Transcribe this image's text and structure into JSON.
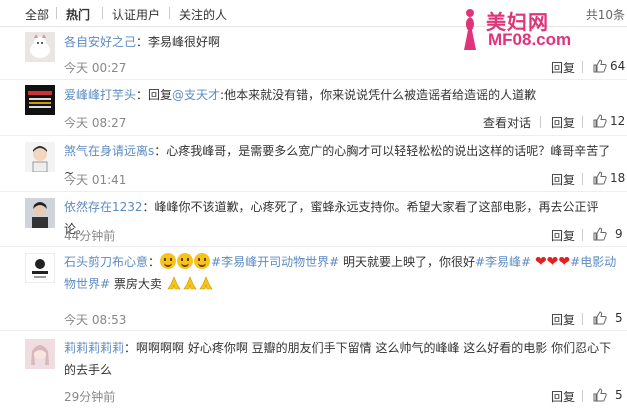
{
  "tabs": [
    "全部",
    "热门",
    "认证用户",
    "关注的人"
  ],
  "active_tab": "热门",
  "total_count": "共10条",
  "logo": {
    "cn": "美妇网",
    "url": "MF08.com"
  },
  "comments": [
    {
      "user": "各自安好之己",
      "text": "：李易峰很好啊",
      "time": "今天 00:27",
      "reply": "回复",
      "likes": "64",
      "extra": ""
    },
    {
      "user": "爱峰峰打芋头",
      "text_prefix": "：回复",
      "mention": "@支天才",
      "text": ":他本来就没有错，你来说说凭什么被造谣者给造谣的人道歉",
      "time": "今天 08:27",
      "reply": "回复",
      "likes": "12",
      "extra": "查看对话"
    },
    {
      "user": "煞气在身请远离s",
      "text": "：心疼我峰哥，是需要多么宽广的心胸才可以轻轻松松的说出这样的话呢？峰哥辛苦了~",
      "time": "今天 01:41",
      "reply": "回复",
      "likes": "18",
      "extra": ""
    },
    {
      "user": "依然存在1232",
      "text": "：峰峰你不该道歉，心疼死了，蜜蜂永远支持你。希望大家看了这部电影，再去公正评论。",
      "time": "44分钟前",
      "reply": "回复",
      "likes": "9",
      "extra": ""
    },
    {
      "user": "石头剪刀布心意",
      "hashtag1": "#李易峰开司动物世界#",
      "text_mid": " 明天就要上映了，你很好",
      "hashtag2": "#李易峰#",
      "hashtag3": "#电影动物世界#",
      "text_end": " 票房大卖",
      "time": "今天 08:53",
      "reply": "回复",
      "likes": "5",
      "extra": ""
    },
    {
      "user": "莉莉莉莉莉",
      "text": "：啊啊啊啊 好心疼你啊 豆瓣的朋友们手下留情 这么帅气的峰峰 这么好看的电影 你们忍心下的去手么",
      "time": "29分钟前",
      "reply": "回复",
      "likes": "5",
      "extra": ""
    }
  ],
  "colors": {
    "link": "#5d8bc4",
    "brand": "#e0337a",
    "heart": "#e02020"
  }
}
